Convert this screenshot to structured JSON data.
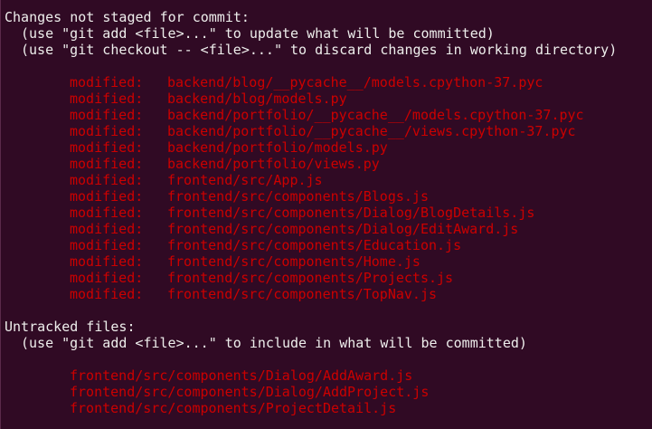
{
  "terminal": {
    "colors": {
      "background": "#300a24",
      "text": "#eeeeec",
      "red": "#cc0000"
    },
    "not_staged": {
      "heading": "Changes not staged for commit:",
      "hints": [
        "(use \"git add <file>...\" to update what will be committed)",
        "(use \"git checkout -- <file>...\" to discard changes in working directory)"
      ],
      "files": [
        {
          "status": "modified:",
          "path": "backend/blog/__pycache__/models.cpython-37.pyc"
        },
        {
          "status": "modified:",
          "path": "backend/blog/models.py"
        },
        {
          "status": "modified:",
          "path": "backend/portfolio/__pycache__/models.cpython-37.pyc"
        },
        {
          "status": "modified:",
          "path": "backend/portfolio/__pycache__/views.cpython-37.pyc"
        },
        {
          "status": "modified:",
          "path": "backend/portfolio/models.py"
        },
        {
          "status": "modified:",
          "path": "backend/portfolio/views.py"
        },
        {
          "status": "modified:",
          "path": "frontend/src/App.js"
        },
        {
          "status": "modified:",
          "path": "frontend/src/components/Blogs.js"
        },
        {
          "status": "modified:",
          "path": "frontend/src/components/Dialog/BlogDetails.js"
        },
        {
          "status": "modified:",
          "path": "frontend/src/components/Dialog/EditAward.js"
        },
        {
          "status": "modified:",
          "path": "frontend/src/components/Education.js"
        },
        {
          "status": "modified:",
          "path": "frontend/src/components/Home.js"
        },
        {
          "status": "modified:",
          "path": "frontend/src/components/Projects.js"
        },
        {
          "status": "modified:",
          "path": "frontend/src/components/TopNav.js"
        }
      ]
    },
    "untracked": {
      "heading": "Untracked files:",
      "hint": "(use \"git add <file>...\" to include in what will be committed)",
      "files": [
        "frontend/src/components/Dialog/AddAward.js",
        "frontend/src/components/Dialog/AddProject.js",
        "frontend/src/components/ProjectDetail.js"
      ]
    }
  }
}
